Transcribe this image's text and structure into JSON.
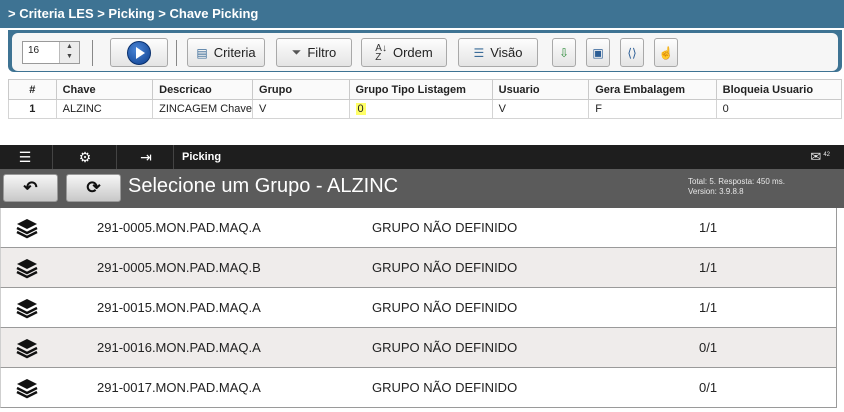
{
  "top": {
    "breadcrumb": "> Criteria LES > Picking > Chave Picking",
    "spinner_value": "16",
    "buttons": {
      "criteria": "Criteria",
      "filtro": "Filtro",
      "ordem": "Ordem",
      "visao": "Visão"
    },
    "table": {
      "headers": [
        "#",
        "Chave",
        "Descricao",
        "Grupo",
        "Grupo Tipo Listagem",
        "Usuario",
        "Gera Embalagem",
        "Bloqueia Usuario"
      ],
      "rows": [
        [
          "1",
          "ALZINC",
          "ZINCAGEM Chave",
          "V",
          "0",
          "V",
          "F",
          "0"
        ]
      ]
    }
  },
  "bottom": {
    "nav": {
      "title": "Picking",
      "mail_count": "42"
    },
    "header": {
      "title": "Selecione um Grupo - ALZINC",
      "stats_line1": "Total: 5. Resposta: 450 ms.",
      "stats_line2": "Version: 3.9.8.8"
    },
    "items": [
      {
        "code": "291-0005.MON.PAD.MAQ.A",
        "group": "GRUPO NÃO DEFINIDO",
        "count": "1/1"
      },
      {
        "code": "291-0005.MON.PAD.MAQ.B",
        "group": "GRUPO NÃO DEFINIDO",
        "count": "1/1"
      },
      {
        "code": "291-0015.MON.PAD.MAQ.A",
        "group": "GRUPO NÃO DEFINIDO",
        "count": "1/1"
      },
      {
        "code": "291-0016.MON.PAD.MAQ.A",
        "group": "GRUPO NÃO DEFINIDO",
        "count": "0/1"
      },
      {
        "code": "291-0017.MON.PAD.MAQ.A",
        "group": "GRUPO NÃO DEFINIDO",
        "count": "0/1"
      }
    ]
  }
}
